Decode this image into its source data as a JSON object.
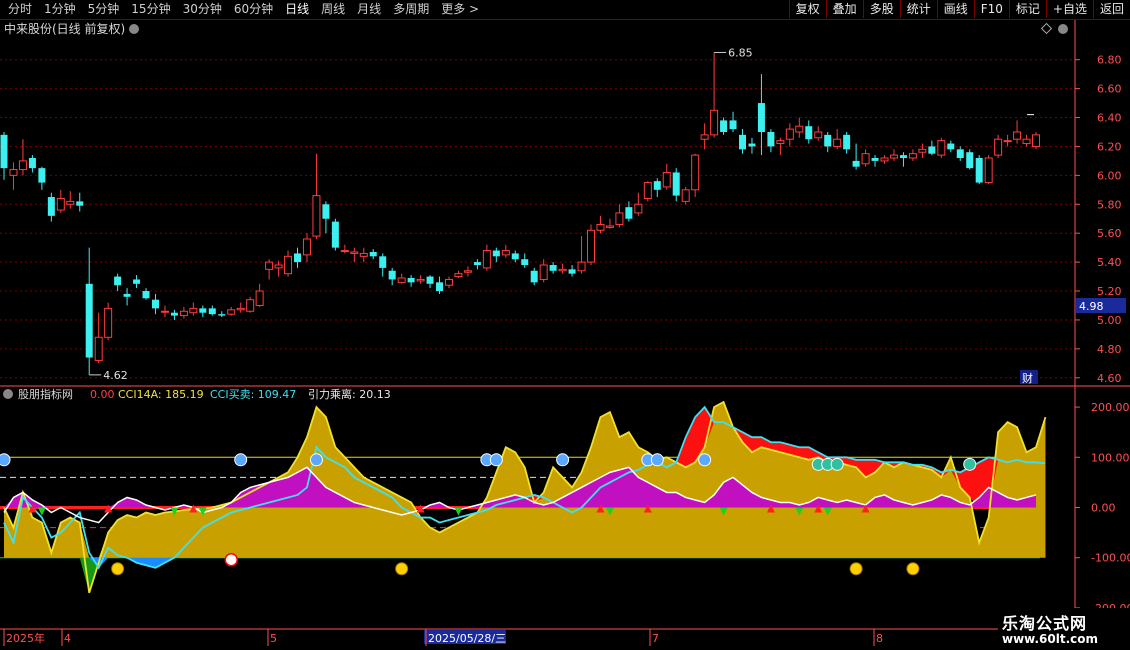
{
  "toolbar": {
    "periods": [
      "分时",
      "1分钟",
      "5分钟",
      "15分钟",
      "30分钟",
      "60分钟",
      "日线",
      "周线",
      "月线",
      "多周期",
      "更多 >"
    ],
    "active_period": "日线",
    "right_buttons": [
      "复权",
      "叠加",
      "多股",
      "统计",
      "画线",
      "F10",
      "标记",
      "+自选",
      "返回"
    ]
  },
  "main_panel": {
    "title": "中来股份(日线 前复权)",
    "high_label": "6.85",
    "low_label": "4.62",
    "current_price": "4.98",
    "fin_badge": "财",
    "price_ticks": [
      6.8,
      6.6,
      6.4,
      6.2,
      6.0,
      5.8,
      5.6,
      5.4,
      5.2,
      5.0,
      4.8,
      4.6
    ]
  },
  "indicator_panel": {
    "name": "股朋指标网",
    "v0": "0.00",
    "cci14a_label": "CCI14A:",
    "cci14a_value": "185.19",
    "cci_buy_label": "CCI买卖:",
    "cci_buy_value": "109.47",
    "gravity_label": "引力乘离:",
    "gravity_value": "20.13",
    "ticks": [
      "200.00",
      "100.00",
      "0.00",
      "-100.00",
      "-200.00"
    ]
  },
  "time_axis": {
    "labels": [
      "2025年",
      "4",
      "5",
      "2025/05/28/三",
      "7",
      "8"
    ],
    "highlight": "2025/05/28/三"
  },
  "watermark": {
    "line1": "乐淘公式网",
    "line2": "www.60lt.com"
  },
  "colors": {
    "up": "#ff3c3c",
    "down": "#3cf0f0",
    "grid": "#7a0000",
    "axis": "#ff5050"
  },
  "chart_data": {
    "type": "candlestick",
    "candles": [
      [
        6.28,
        6.05,
        6.3,
        5.97
      ],
      [
        6.0,
        6.04,
        6.09,
        5.9
      ],
      [
        6.04,
        6.1,
        6.25,
        6.0
      ],
      [
        6.12,
        6.05,
        6.14,
        6.02
      ],
      [
        6.05,
        5.95,
        6.06,
        5.9
      ],
      [
        5.85,
        5.72,
        5.88,
        5.68
      ],
      [
        5.76,
        5.84,
        5.9,
        5.74
      ],
      [
        5.8,
        5.82,
        5.89,
        5.77
      ],
      [
        5.82,
        5.79,
        5.88,
        5.75
      ],
      [
        5.25,
        4.74,
        5.5,
        4.62
      ],
      [
        4.72,
        4.88,
        5.05,
        4.7
      ],
      [
        4.88,
        5.08,
        5.12,
        4.86
      ],
      [
        5.3,
        5.24,
        5.32,
        5.2
      ],
      [
        5.18,
        5.16,
        5.22,
        5.1
      ],
      [
        5.28,
        5.25,
        5.31,
        5.22
      ],
      [
        5.2,
        5.15,
        5.22,
        5.14
      ],
      [
        5.14,
        5.08,
        5.18,
        5.04
      ],
      [
        5.06,
        5.06,
        5.1,
        5.02
      ],
      [
        5.05,
        5.03,
        5.07,
        5.0
      ],
      [
        5.03,
        5.06,
        5.09,
        5.01
      ],
      [
        5.05,
        5.08,
        5.12,
        5.03
      ],
      [
        5.08,
        5.05,
        5.1,
        5.02
      ],
      [
        5.08,
        5.04,
        5.1,
        5.03
      ],
      [
        5.04,
        5.03,
        5.06,
        5.02
      ],
      [
        5.04,
        5.07,
        5.09,
        5.03
      ],
      [
        5.07,
        5.08,
        5.12,
        5.05
      ],
      [
        5.06,
        5.14,
        5.16,
        5.05
      ],
      [
        5.1,
        5.2,
        5.25,
        5.09
      ],
      [
        5.35,
        5.4,
        5.42,
        5.28
      ],
      [
        5.36,
        5.38,
        5.41,
        5.3
      ],
      [
        5.32,
        5.44,
        5.48,
        5.3
      ],
      [
        5.46,
        5.4,
        5.5,
        5.36
      ],
      [
        5.45,
        5.56,
        5.6,
        5.4
      ],
      [
        5.58,
        5.86,
        6.15,
        5.56
      ],
      [
        5.8,
        5.7,
        5.82,
        5.6
      ],
      [
        5.68,
        5.5,
        5.7,
        5.48
      ],
      [
        5.48,
        5.48,
        5.52,
        5.46
      ],
      [
        5.46,
        5.47,
        5.5,
        5.4
      ],
      [
        5.44,
        5.46,
        5.5,
        5.4
      ],
      [
        5.47,
        5.44,
        5.49,
        5.42
      ],
      [
        5.44,
        5.36,
        5.46,
        5.3
      ],
      [
        5.34,
        5.28,
        5.36,
        5.24
      ],
      [
        5.26,
        5.29,
        5.32,
        5.25
      ],
      [
        5.29,
        5.26,
        5.31,
        5.23
      ],
      [
        5.27,
        5.28,
        5.31,
        5.25
      ],
      [
        5.3,
        5.25,
        5.31,
        5.22
      ],
      [
        5.26,
        5.2,
        5.3,
        5.18
      ],
      [
        5.24,
        5.28,
        5.3,
        5.22
      ],
      [
        5.3,
        5.32,
        5.34,
        5.29
      ],
      [
        5.33,
        5.34,
        5.37,
        5.3
      ],
      [
        5.4,
        5.38,
        5.42,
        5.35
      ],
      [
        5.36,
        5.48,
        5.52,
        5.34
      ],
      [
        5.48,
        5.44,
        5.5,
        5.4
      ],
      [
        5.45,
        5.48,
        5.52,
        5.43
      ],
      [
        5.46,
        5.42,
        5.48,
        5.4
      ],
      [
        5.42,
        5.38,
        5.46,
        5.36
      ],
      [
        5.34,
        5.26,
        5.36,
        5.24
      ],
      [
        5.28,
        5.38,
        5.42,
        5.26
      ],
      [
        5.38,
        5.34,
        5.4,
        5.32
      ],
      [
        5.34,
        5.35,
        5.39,
        5.32
      ],
      [
        5.35,
        5.32,
        5.38,
        5.3
      ],
      [
        5.34,
        5.4,
        5.58,
        5.32
      ],
      [
        5.4,
        5.62,
        5.66,
        5.38
      ],
      [
        5.62,
        5.66,
        5.72,
        5.6
      ],
      [
        5.64,
        5.65,
        5.7,
        5.63
      ],
      [
        5.66,
        5.74,
        5.8,
        5.64
      ],
      [
        5.78,
        5.7,
        5.82,
        5.68
      ],
      [
        5.74,
        5.8,
        5.88,
        5.72
      ],
      [
        5.84,
        5.95,
        5.96,
        5.82
      ],
      [
        5.96,
        5.9,
        5.98,
        5.85
      ],
      [
        5.92,
        6.02,
        6.08,
        5.9
      ],
      [
        6.02,
        5.86,
        6.05,
        5.82
      ],
      [
        5.82,
        5.9,
        5.92,
        5.8
      ],
      [
        5.9,
        6.14,
        6.15,
        5.85
      ],
      [
        6.25,
        6.28,
        6.36,
        6.18
      ],
      [
        6.28,
        6.45,
        6.85,
        6.26
      ],
      [
        6.38,
        6.3,
        6.4,
        6.28
      ],
      [
        6.38,
        6.32,
        6.44,
        6.3
      ],
      [
        6.28,
        6.18,
        6.32,
        6.15
      ],
      [
        6.22,
        6.2,
        6.26,
        6.15
      ],
      [
        6.5,
        6.3,
        6.7,
        6.14
      ],
      [
        6.3,
        6.2,
        6.32,
        6.16
      ],
      [
        6.22,
        6.24,
        6.26,
        6.14
      ],
      [
        6.25,
        6.32,
        6.36,
        6.2
      ],
      [
        6.3,
        6.34,
        6.4,
        6.26
      ],
      [
        6.34,
        6.25,
        6.38,
        6.22
      ],
      [
        6.26,
        6.3,
        6.34,
        6.24
      ],
      [
        6.28,
        6.2,
        6.3,
        6.16
      ],
      [
        6.2,
        6.25,
        6.32,
        6.18
      ],
      [
        6.28,
        6.18,
        6.3,
        6.15
      ],
      [
        6.1,
        6.06,
        6.22,
        6.04
      ],
      [
        6.08,
        6.15,
        6.18,
        6.06
      ],
      [
        6.12,
        6.1,
        6.14,
        6.06
      ],
      [
        6.1,
        6.12,
        6.14,
        6.08
      ],
      [
        6.12,
        6.14,
        6.18,
        6.1
      ],
      [
        6.14,
        6.12,
        6.16,
        6.06
      ],
      [
        6.12,
        6.15,
        6.18,
        6.1
      ],
      [
        6.16,
        6.18,
        6.22,
        6.12
      ],
      [
        6.2,
        6.15,
        6.24,
        6.14
      ],
      [
        6.14,
        6.24,
        6.26,
        6.12
      ],
      [
        6.22,
        6.18,
        6.24,
        6.16
      ],
      [
        6.18,
        6.12,
        6.2,
        6.1
      ],
      [
        6.16,
        6.05,
        6.18,
        6.04
      ],
      [
        6.12,
        5.95,
        6.14,
        5.94
      ],
      [
        5.95,
        6.12,
        6.14,
        5.94
      ],
      [
        6.14,
        6.25,
        6.28,
        6.12
      ],
      [
        6.24,
        6.24,
        6.28,
        6.2
      ],
      [
        6.25,
        6.3,
        6.38,
        6.22
      ],
      [
        6.22,
        6.25,
        6.28,
        6.2
      ],
      [
        6.2,
        6.28,
        6.3,
        6.18
      ]
    ],
    "ylim": [
      4.55,
      6.95
    ],
    "indicator": {
      "ylim": [
        -240,
        240
      ],
      "cci": [
        0,
        -40,
        30,
        -20,
        -30,
        -90,
        -30,
        -20,
        -30,
        -170,
        -110,
        -50,
        -25,
        -15,
        -20,
        -10,
        -15,
        -10,
        -8,
        -5,
        -3,
        -2,
        0,
        5,
        10,
        20,
        30,
        40,
        50,
        60,
        70,
        100,
        140,
        200,
        180,
        120,
        100,
        80,
        60,
        50,
        40,
        30,
        20,
        10,
        -20,
        -40,
        -50,
        -40,
        -30,
        -20,
        -10,
        20,
        70,
        120,
        110,
        80,
        10,
        30,
        80,
        60,
        40,
        70,
        120,
        180,
        190,
        140,
        150,
        120,
        110,
        95,
        100,
        90,
        80,
        90,
        120,
        200,
        210,
        160,
        130,
        110,
        120,
        115,
        110,
        105,
        100,
        95,
        100,
        90,
        90,
        85,
        80,
        60,
        70,
        90,
        80,
        90,
        85,
        80,
        75,
        60,
        100,
        40,
        20,
        -70,
        -20,
        150,
        170,
        160,
        110,
        120,
        180
      ],
      "cci_buy": [
        -30,
        -70,
        20,
        0,
        -20,
        -60,
        -50,
        -30,
        -10,
        -90,
        -120,
        -80,
        -95,
        -100,
        -110,
        -115,
        -120,
        -110,
        -100,
        -80,
        -60,
        -40,
        -30,
        -20,
        -10,
        -5,
        0,
        5,
        10,
        15,
        20,
        25,
        40,
        120,
        100,
        90,
        80,
        60,
        50,
        40,
        30,
        20,
        0,
        -10,
        -20,
        -20,
        -30,
        -25,
        -20,
        -15,
        -10,
        -5,
        5,
        10,
        15,
        20,
        25,
        20,
        10,
        0,
        -10,
        0,
        20,
        40,
        50,
        60,
        70,
        75,
        85,
        90,
        80,
        90,
        140,
        180,
        200,
        170,
        170,
        160,
        150,
        140,
        140,
        130,
        130,
        125,
        120,
        120,
        110,
        100,
        100,
        100,
        95,
        95,
        95,
        90,
        90,
        90,
        85,
        85,
        80,
        70,
        75,
        70,
        80,
        90,
        100,
        95,
        90,
        95,
        90,
        90,
        88
      ],
      "gravity": [
        -10,
        20,
        30,
        15,
        5,
        -10,
        0,
        -10,
        -20,
        -25,
        -30,
        -10,
        10,
        20,
        15,
        5,
        0,
        -5,
        0,
        5,
        0,
        -10,
        -5,
        0,
        10,
        30,
        40,
        45,
        50,
        55,
        60,
        70,
        80,
        60,
        40,
        30,
        20,
        10,
        5,
        0,
        -5,
        -10,
        -15,
        -10,
        -5,
        5,
        10,
        0,
        -5,
        0,
        5,
        10,
        15,
        20,
        25,
        20,
        10,
        5,
        10,
        20,
        30,
        40,
        50,
        60,
        70,
        75,
        80,
        60,
        50,
        40,
        30,
        30,
        20,
        15,
        10,
        25,
        50,
        60,
        45,
        30,
        20,
        15,
        10,
        10,
        5,
        10,
        20,
        15,
        10,
        15,
        10,
        5,
        20,
        25,
        15,
        10,
        5,
        10,
        15,
        25,
        20,
        10,
        5,
        20,
        40,
        30,
        20,
        15,
        20,
        25
      ],
      "buy_dots": [
        0,
        25,
        33,
        51,
        52,
        59,
        68,
        69,
        74
      ],
      "sell_dots": [
        12,
        42,
        90,
        96
      ],
      "top_signals": [
        86,
        87,
        88,
        102
      ]
    }
  }
}
